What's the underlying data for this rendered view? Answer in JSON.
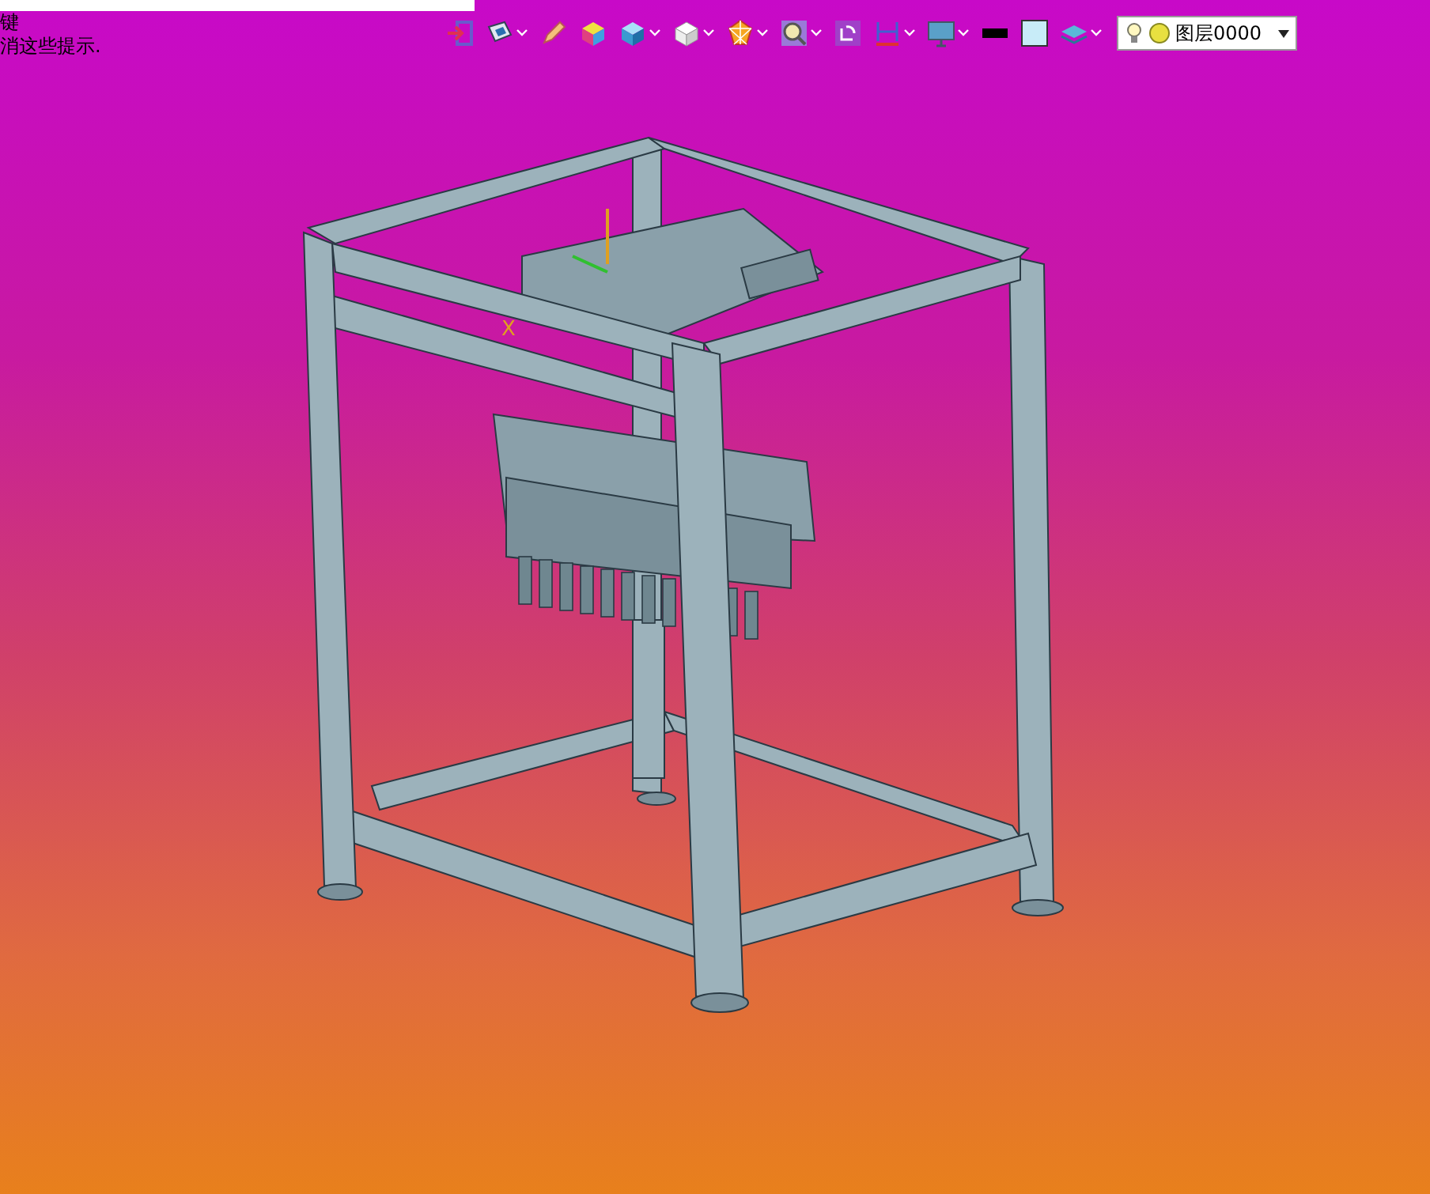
{
  "hints": [
    "键",
    "消这些提示."
  ],
  "toolbar": [
    {
      "kind": "exit",
      "dropdown": false
    },
    {
      "kind": "view",
      "dropdown": true
    },
    {
      "kind": "pen",
      "dropdown": false
    },
    {
      "kind": "colorcube",
      "dropdown": false
    },
    {
      "kind": "bluecube",
      "dropdown": true
    },
    {
      "kind": "whitecube",
      "dropdown": true
    },
    {
      "kind": "polygon",
      "dropdown": true
    },
    {
      "kind": "zoom",
      "dropdown": true
    },
    {
      "kind": "rotate",
      "dropdown": false
    },
    {
      "kind": "dimension",
      "dropdown": true
    },
    {
      "kind": "monitor",
      "dropdown": true
    },
    {
      "kind": "linecolor",
      "dropdown": false
    },
    {
      "kind": "fillcolor",
      "dropdown": false
    },
    {
      "kind": "layers",
      "dropdown": true
    }
  ],
  "layer_select": {
    "value": "图层0000"
  },
  "axis_label": "X"
}
